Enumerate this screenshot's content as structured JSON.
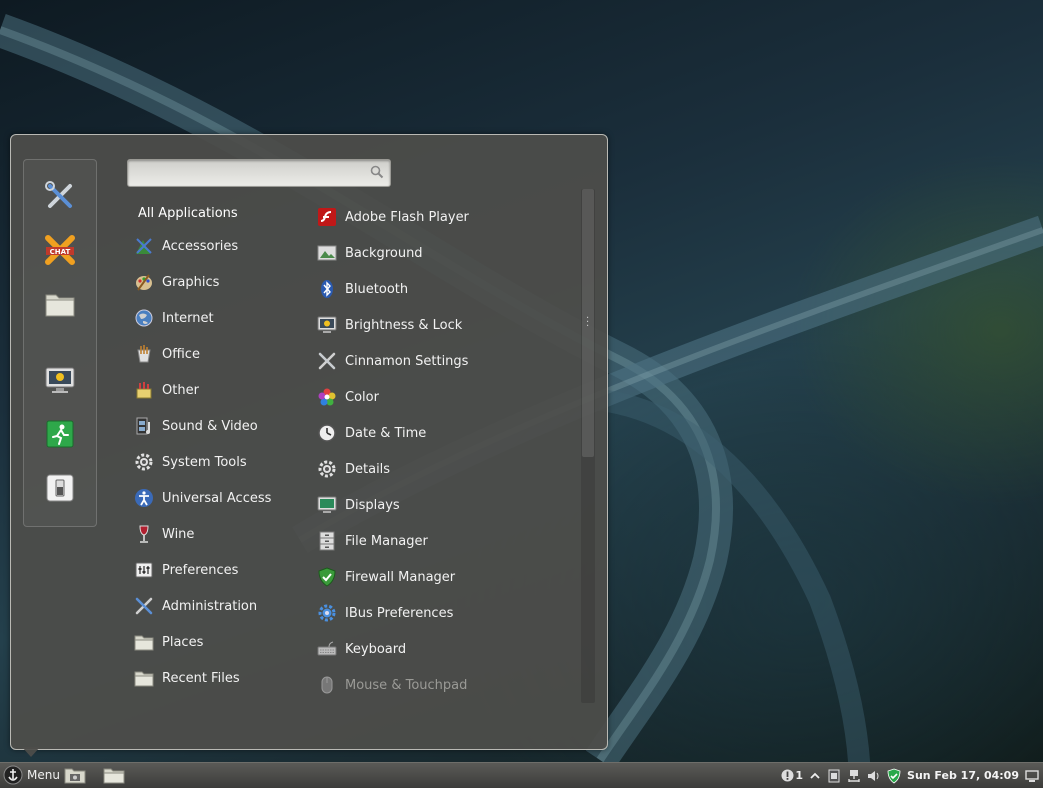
{
  "search": {
    "placeholder": "",
    "value": ""
  },
  "favorites": [
    {
      "name": "cinnamon-settings"
    },
    {
      "name": "xchat"
    },
    {
      "name": "file-manager"
    },
    {
      "name": "screensaver-lock"
    },
    {
      "name": "logout"
    },
    {
      "name": "shutdown"
    }
  ],
  "categories": [
    {
      "label": "All Applications",
      "icon": "none"
    },
    {
      "label": "Accessories",
      "icon": "accessories-icon"
    },
    {
      "label": "Graphics",
      "icon": "graphics-palette-icon"
    },
    {
      "label": "Internet",
      "icon": "globe-icon"
    },
    {
      "label": "Office",
      "icon": "office-icon"
    },
    {
      "label": "Other",
      "icon": "other-icon"
    },
    {
      "label": "Sound & Video",
      "icon": "film-music-icon"
    },
    {
      "label": "System Tools",
      "icon": "gear-icon"
    },
    {
      "label": "Universal Access",
      "icon": "accessibility-icon"
    },
    {
      "label": "Wine",
      "icon": "wine-glass-icon"
    },
    {
      "label": "Preferences",
      "icon": "preferences-icon"
    },
    {
      "label": "Administration",
      "icon": "tools-icon"
    },
    {
      "label": "Places",
      "icon": "folder-icon"
    },
    {
      "label": "Recent Files",
      "icon": "folder-icon"
    }
  ],
  "apps": [
    {
      "label": "Adobe Flash Player",
      "icon": "flash-icon"
    },
    {
      "label": "Background",
      "icon": "background-icon"
    },
    {
      "label": "Bluetooth",
      "icon": "bluetooth-icon"
    },
    {
      "label": "Brightness & Lock",
      "icon": "brightness-icon"
    },
    {
      "label": "Cinnamon Settings",
      "icon": "tools-icon"
    },
    {
      "label": "Color",
      "icon": "color-icon"
    },
    {
      "label": "Date & Time",
      "icon": "clock-icon"
    },
    {
      "label": "Details",
      "icon": "gear-icon"
    },
    {
      "label": "Displays",
      "icon": "display-icon"
    },
    {
      "label": "File Manager",
      "icon": "file-cabinet-icon"
    },
    {
      "label": "Firewall Manager",
      "icon": "shield-icon"
    },
    {
      "label": "IBus Preferences",
      "icon": "gear-blue-icon"
    },
    {
      "label": "Keyboard",
      "icon": "keyboard-icon"
    },
    {
      "label": "Mouse & Touchpad",
      "icon": "mouse-icon"
    }
  ],
  "panel": {
    "menu_label": "Menu",
    "notification_count": "1",
    "clock": "Sun Feb 17, 04:09"
  },
  "colors": {
    "accent": "#3a9a3a",
    "panel": "#4a4a47",
    "menu_bg": "#4e4e4a"
  }
}
